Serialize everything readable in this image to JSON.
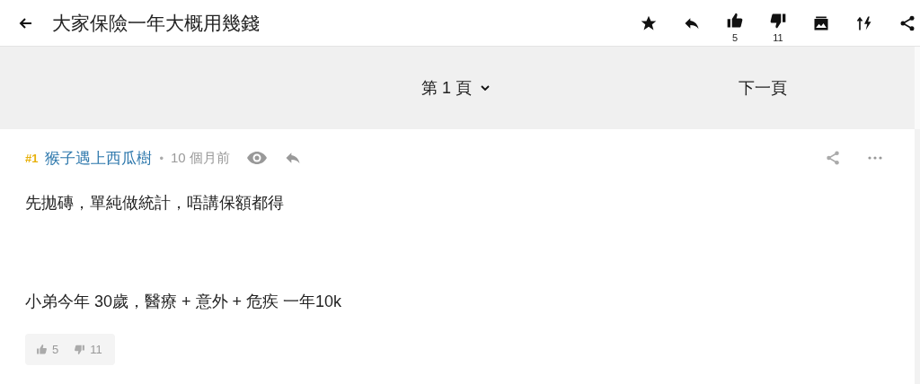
{
  "header": {
    "title": "大家保險一年大概用幾錢",
    "likes": "5",
    "dislikes": "11"
  },
  "pager": {
    "page": "第 1 頁",
    "next": "下一頁"
  },
  "post": {
    "number": "#1",
    "author": "猴子遇上西瓜樹",
    "separator": "•",
    "time": "10 個月前",
    "paragraphs": [
      "先拋磚，單純做統計，唔講保額都得",
      "小弟今年 30歲，醫療 + 意外 + 危疾 一年10k"
    ],
    "likes": "5",
    "dislikes": "11"
  }
}
